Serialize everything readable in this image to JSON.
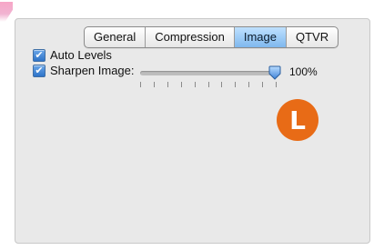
{
  "tabs": [
    {
      "label": "General",
      "active": false
    },
    {
      "label": "Compression",
      "active": false
    },
    {
      "label": "Image",
      "active": true
    },
    {
      "label": "QTVR",
      "active": false
    }
  ],
  "options": {
    "auto_levels": {
      "label": "Auto Levels",
      "checked": true
    },
    "sharpen_image": {
      "label": "Sharpen Image:",
      "checked": true
    }
  },
  "sharpen_slider": {
    "value_percent": 100,
    "value_label": "100%",
    "tick_count": 11
  },
  "badge": {
    "letter": "L",
    "color": "#e86b16"
  },
  "colors": {
    "panel_bg": "#e9e9e9",
    "selected_tab": "#8fc3f2",
    "checkbox_blue": "#2e73c8"
  },
  "icons": {
    "check": "checkmark-icon",
    "slider_thumb": "slider-thumb-icon"
  }
}
